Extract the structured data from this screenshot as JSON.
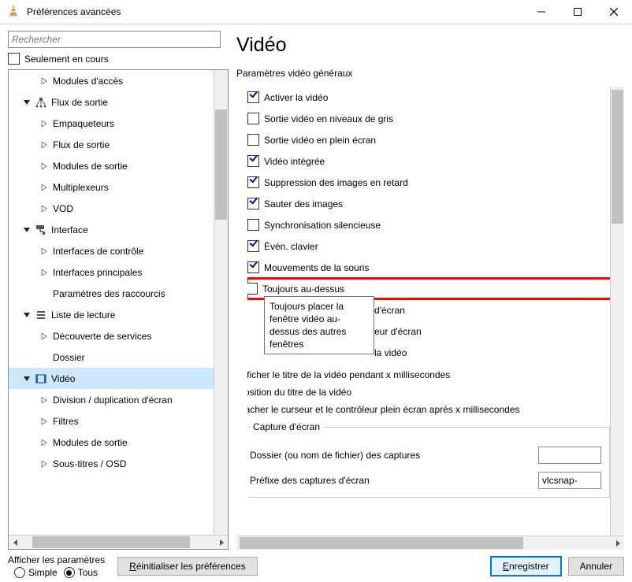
{
  "window": {
    "title": "Préférences avancées"
  },
  "search": {
    "placeholder": "Rechercher",
    "only_current_label": "Seulement en cours"
  },
  "tree": [
    {
      "level": 1,
      "icon": "arrow-closed",
      "label": "Modules d'accès"
    },
    {
      "level": 0,
      "icon": "arrow-open",
      "glyph": "stream",
      "label": "Flux de sortie"
    },
    {
      "level": 1,
      "icon": "arrow-closed",
      "label": "Empaqueteurs"
    },
    {
      "level": 1,
      "icon": "arrow-closed",
      "label": "Flux de sortie"
    },
    {
      "level": 1,
      "icon": "arrow-closed",
      "label": "Modules de sortie"
    },
    {
      "level": 1,
      "icon": "arrow-closed",
      "label": "Multiplexeurs"
    },
    {
      "level": 1,
      "icon": "arrow-closed",
      "label": "VOD"
    },
    {
      "level": 0,
      "icon": "arrow-open",
      "glyph": "paint",
      "label": "Interface"
    },
    {
      "level": 1,
      "icon": "arrow-closed",
      "label": "Interfaces de contrôle"
    },
    {
      "level": 1,
      "icon": "arrow-closed",
      "label": "Interfaces principales"
    },
    {
      "level": 1,
      "icon": "none",
      "label": "Paramètres des raccourcis"
    },
    {
      "level": 0,
      "icon": "arrow-open",
      "glyph": "list",
      "label": "Liste de lecture"
    },
    {
      "level": 1,
      "icon": "arrow-closed",
      "label": "Découverte de services"
    },
    {
      "level": 1,
      "icon": "none",
      "label": "Dossier"
    },
    {
      "level": 0,
      "icon": "arrow-open",
      "glyph": "video",
      "label": "Vidéo",
      "selected": true
    },
    {
      "level": 1,
      "icon": "arrow-closed",
      "label": "Division / duplication d'écran"
    },
    {
      "level": 1,
      "icon": "arrow-closed",
      "label": "Filtres"
    },
    {
      "level": 1,
      "icon": "arrow-closed",
      "label": "Modules de sortie"
    },
    {
      "level": 1,
      "icon": "arrow-closed",
      "label": "Sous-titres / OSD"
    }
  ],
  "right": {
    "heading": "Vidéo",
    "section_label": "Paramètres vidéo généraux",
    "options": [
      {
        "checked": true,
        "label": "Activer la vidéo"
      },
      {
        "checked": false,
        "label": "Sortie vidéo en niveaux de gris"
      },
      {
        "checked": false,
        "label": "Sortie vidéo en plein écran"
      },
      {
        "checked": true,
        "label": "Vidéo intégrée"
      },
      {
        "checked": true,
        "label": "Suppression des images en retard"
      },
      {
        "checked": true,
        "label": "Sauter des images"
      },
      {
        "checked": false,
        "label": "Synchronisation silencieuse"
      },
      {
        "checked": true,
        "label": "Évén. clavier"
      },
      {
        "checked": true,
        "label": "Mouvements de la souris"
      },
      {
        "checked": false,
        "label": "Toujours au-dessus",
        "highlighted": true
      },
      {
        "checked": false,
        "label": "d'écran",
        "obscured": true
      },
      {
        "checked": true,
        "label": "eur d'écran",
        "obscured": true
      },
      {
        "checked": true,
        "label": "la vidéo",
        "obscured": true
      }
    ],
    "tooltip": "Toujours placer la fenêtre vidéo au-dessus des autres fenêtres",
    "subheadings": [
      "Afficher le titre de la vidéo pendant x millisecondes",
      "Position du titre de la vidéo",
      "Cacher le curseur et le contrôleur plein écran après x millisecondes"
    ],
    "group": {
      "legend": "Capture d'écran",
      "folder_label": "Dossier (ou nom de fichier) des captures",
      "prefix_label": "Préfixe des captures d'écran",
      "prefix_value": "vlcsnap-"
    }
  },
  "footer": {
    "show_params_label": "Afficher les paramètres",
    "simple_label": "Simple",
    "tous_label": "Tous",
    "reset_label": "Réinitialiser les préférences",
    "save_label": "Enregistrer",
    "cancel_label": "Annuler"
  }
}
